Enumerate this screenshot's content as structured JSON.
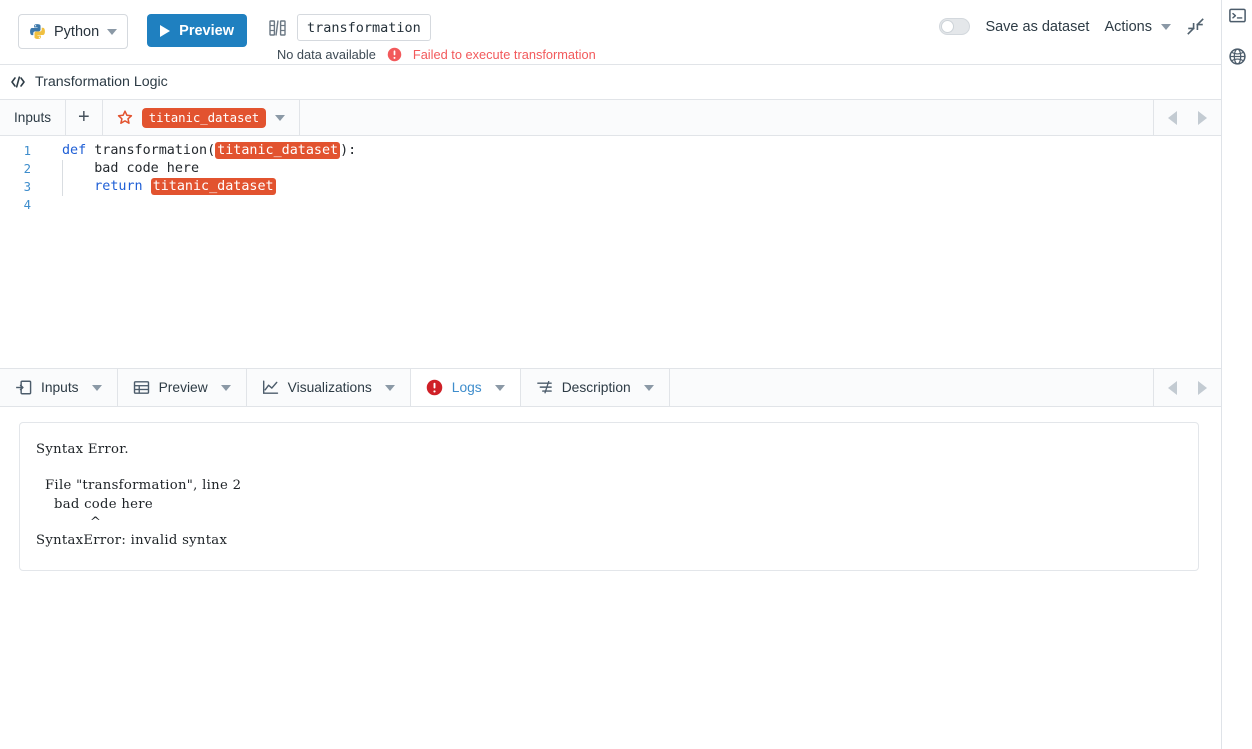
{
  "header": {
    "language": "Python",
    "language_icon": "python-logo-icon",
    "preview_label": "Preview",
    "preview_icon": "play-icon",
    "transformation_icon": "transformation-icon",
    "transformation_name": "transformation",
    "status_text": "No data available",
    "error_icon": "error-exclamation-icon",
    "error_text": "Failed to execute transformation",
    "toggle_label": "Save as dataset",
    "toggle_state": "off",
    "actions_label": "Actions",
    "actions_caret_icon": "chevron-down-icon",
    "collapse_icon": "collapse-arrows-icon"
  },
  "logic_bar": {
    "code_icon": "code-brackets-icon",
    "title": "Transformation Logic"
  },
  "inputs_bar": {
    "label": "Inputs",
    "add_icon": "plus-icon",
    "dataset_icon": "dataset-star-icon",
    "dataset_name": "titanic_dataset",
    "dataset_caret_icon": "chevron-down-icon",
    "nav_prev_icon": "arrow-left-icon",
    "nav_next_icon": "arrow-right-icon"
  },
  "editor": {
    "lines": [
      {
        "number": "1",
        "segments": [
          {
            "text": "def ",
            "type": "keyword"
          },
          {
            "text": "transformation(",
            "type": "plain"
          },
          {
            "text": "titanic_dataset",
            "type": "variable"
          },
          {
            "text": "):",
            "type": "plain"
          }
        ]
      },
      {
        "number": "2",
        "segments": [
          {
            "text": "    bad code here",
            "type": "plain"
          }
        ]
      },
      {
        "number": "3",
        "segments": [
          {
            "text": "    ",
            "type": "plain"
          },
          {
            "text": "return ",
            "type": "keyword"
          },
          {
            "text": "titanic_dataset",
            "type": "variable"
          }
        ]
      },
      {
        "number": "4",
        "segments": []
      }
    ]
  },
  "tabs": [
    {
      "label": "Inputs",
      "icon": "inputs-icon",
      "active": false
    },
    {
      "label": "Preview",
      "icon": "table-icon",
      "active": false
    },
    {
      "label": "Visualizations",
      "icon": "line-chart-icon",
      "active": false
    },
    {
      "label": "Logs",
      "icon": "error-exclamation-icon",
      "active": true
    },
    {
      "label": "Description",
      "icon": "description-icon",
      "active": false
    }
  ],
  "tabbar": {
    "nav_prev_icon": "arrow-left-icon",
    "nav_next_icon": "arrow-right-icon"
  },
  "logs": {
    "content": "Syntax Error.\n\n  File \"transformation\", line 2\n    bad code here\n            ^\nSyntaxError: invalid syntax"
  },
  "rail": {
    "items": [
      {
        "icon": "terminal-icon",
        "name": "terminal"
      },
      {
        "icon": "globe-icon",
        "name": "globe"
      }
    ]
  },
  "colors": {
    "accent_blue": "#1f80c0",
    "link_blue": "#3e8dcc",
    "error_red": "#f2595b",
    "dataset_orange": "#e2532f",
    "keyword_blue": "#1f5fd6",
    "border": "#e1e4e8"
  }
}
